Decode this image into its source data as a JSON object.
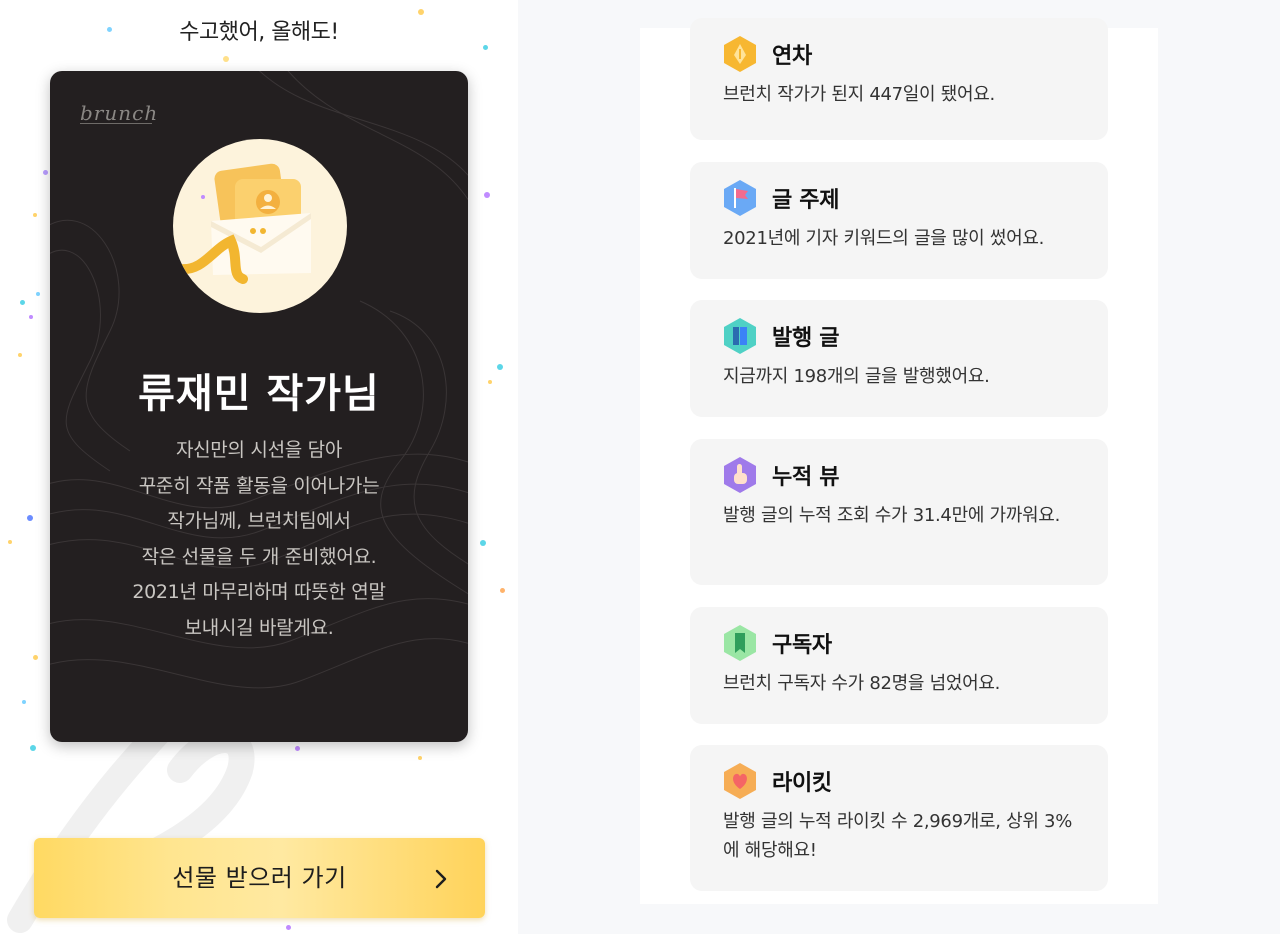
{
  "header": {
    "title": "수고했어, 올해도!"
  },
  "card": {
    "logo": "brunch",
    "writer_name": "류재민 작가님",
    "message_lines": [
      "자신만의 시선을 담아",
      "꾸준히 작품 활동을 이어나가는",
      "작가님께, 브런치팀에서",
      "작은 선물을 두 개 준비했어요.",
      "2021년 마무리하며 따뜻한 연말",
      "보내시길 바랄게요."
    ]
  },
  "gift_button": {
    "label": "선물 받으러 가기",
    "icon": "chevron-right-icon"
  },
  "stats": [
    {
      "icon": "pen-nib-icon",
      "title": "연차",
      "desc": "브런치 작가가 된지 447일이 됐어요.",
      "color": "#f7b731"
    },
    {
      "icon": "flag-icon",
      "title": "글 주제",
      "desc": "2021년에 기자 키워드의 글을 많이 썼어요.",
      "color": "#6aa9f5"
    },
    {
      "icon": "book-icon",
      "title": "발행 글",
      "desc": "지금까지 198개의 글을 발행했어요.",
      "color": "#4fd1c5"
    },
    {
      "icon": "pointer-hand-icon",
      "title": "누적 뷰",
      "desc": "발행 글의 누적 조회 수가 31.4만에 가까워요.",
      "color": "#9f7aea"
    },
    {
      "icon": "bookmark-icon",
      "title": "구독자",
      "desc": "브런치 구독자 수가 82명을 넘었어요.",
      "color": "#68d391"
    },
    {
      "icon": "heart-icon",
      "title": "라이킷",
      "desc": "발행 글의 누적 라이킷 수 2,969개로, 상위 3%에 해당해요!",
      "color": "#f6ad55"
    }
  ],
  "colors": {
    "card_background": "#231f20",
    "button_yellow": "#ffd962",
    "stat_card_background": "#f5f5f5",
    "page_background": "#f7f8fa"
  }
}
